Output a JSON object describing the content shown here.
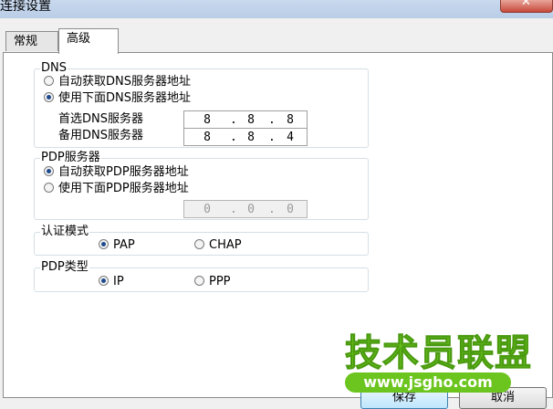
{
  "window": {
    "title": "连接设置",
    "close_glyph": "✕"
  },
  "tabs": [
    {
      "label": "常规"
    },
    {
      "label": "高级"
    }
  ],
  "dns": {
    "legend": "DNS",
    "auto_label": "自动获取DNS服务器地址",
    "manual_label": "使用下面DNS服务器地址",
    "selected": "manual",
    "primary_label": "首选DNS服务器",
    "primary_ip": [
      "",
      "8",
      "8",
      "8"
    ],
    "secondary_label": "备用DNS服务器",
    "secondary_ip": [
      "",
      "8",
      "8",
      "4"
    ]
  },
  "pdp_server": {
    "legend": "PDP服务器",
    "auto_label": "自动获取PDP服务器地址",
    "manual_label": "使用下面PDP服务器地址",
    "selected": "auto",
    "ip": [
      "",
      "0",
      "0",
      "0"
    ]
  },
  "auth": {
    "legend": "认证模式",
    "options": [
      "PAP",
      "CHAP"
    ],
    "selected": "PAP"
  },
  "pdp_type": {
    "legend": "PDP类型",
    "options": [
      "IP",
      "PPP"
    ],
    "selected": "IP"
  },
  "buttons": {
    "save": "保存",
    "cancel": "取消"
  },
  "watermark": {
    "text": "技术员联盟",
    "url": "www.jsgho.com"
  },
  "colors": {
    "accent": "#1f4a8c",
    "watermark_green": "#6cc51e",
    "panel_border": "#8c8c8c"
  }
}
